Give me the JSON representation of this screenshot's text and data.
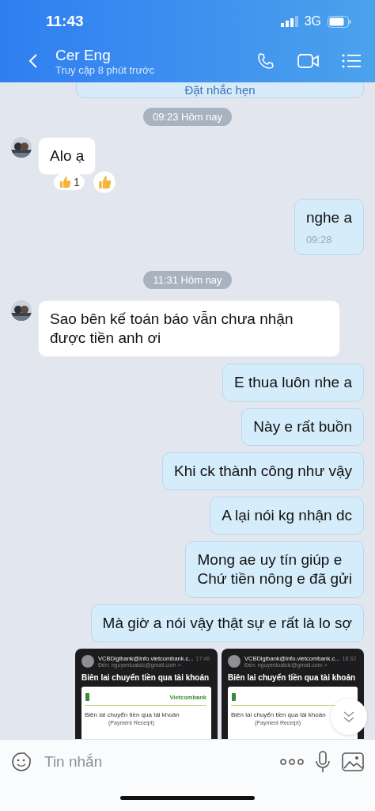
{
  "status_bar": {
    "time": "11:43",
    "network": "3G"
  },
  "header": {
    "title": "Cer Eng",
    "subtitle": "Truy cập 8 phút trước"
  },
  "reminder": {
    "label": "Đặt nhắc hẹn"
  },
  "messages": [
    {
      "kind": "time",
      "text": "09:23 Hôm nay"
    },
    {
      "kind": "incoming",
      "text": "Alo ạ",
      "reaction_count": "1"
    },
    {
      "kind": "outgoing",
      "text": "nghe a",
      "time": "09:28"
    },
    {
      "kind": "time",
      "text": "11:31 Hôm nay"
    },
    {
      "kind": "incoming",
      "text": "Sao bên kế toán báo vẫn chưa nhận được tiền anh ơi"
    },
    {
      "kind": "outgoing",
      "text": "E thua luôn nhe a"
    },
    {
      "kind": "outgoing",
      "text": "Này e rất buồn"
    },
    {
      "kind": "outgoing",
      "text": "Khi ck thành công như vậy"
    },
    {
      "kind": "outgoing",
      "text": "A lại nói kg nhận dc"
    },
    {
      "kind": "outgoing",
      "text": "Mong ae uy tín giúp e\nChứ tiền nông e đã gửi"
    },
    {
      "kind": "outgoing",
      "text": "Mà giờ a nói vậy thật sự e rất là lo sợ"
    },
    {
      "kind": "images",
      "images": [
        {
          "sender": "VCBDigibank@info.vietcombank.c...",
          "time": "17:46",
          "to": "Đến: nguyenluatsic@gmail.com >",
          "title": "Biên lai chuyển tiền qua tài khoản",
          "receipt_title": "Biên lai chuyển tiền qua tài khoản",
          "receipt_subtitle": "(Payment Receipt)",
          "bank": "Vietcombank"
        },
        {
          "sender": "VCBDigibank@info.vietcombank.c...",
          "time": "18:32",
          "to": "Đến: nguyenluatsic@gmail.com >",
          "title": "Biên lai chuyển tiền qua tài khoản",
          "receipt_title": "Biên lai chuyển tiền qua tài khoản",
          "receipt_subtitle": "(Payment Receipt)"
        }
      ]
    }
  ],
  "composer": {
    "placeholder": "Tin nhắn"
  }
}
